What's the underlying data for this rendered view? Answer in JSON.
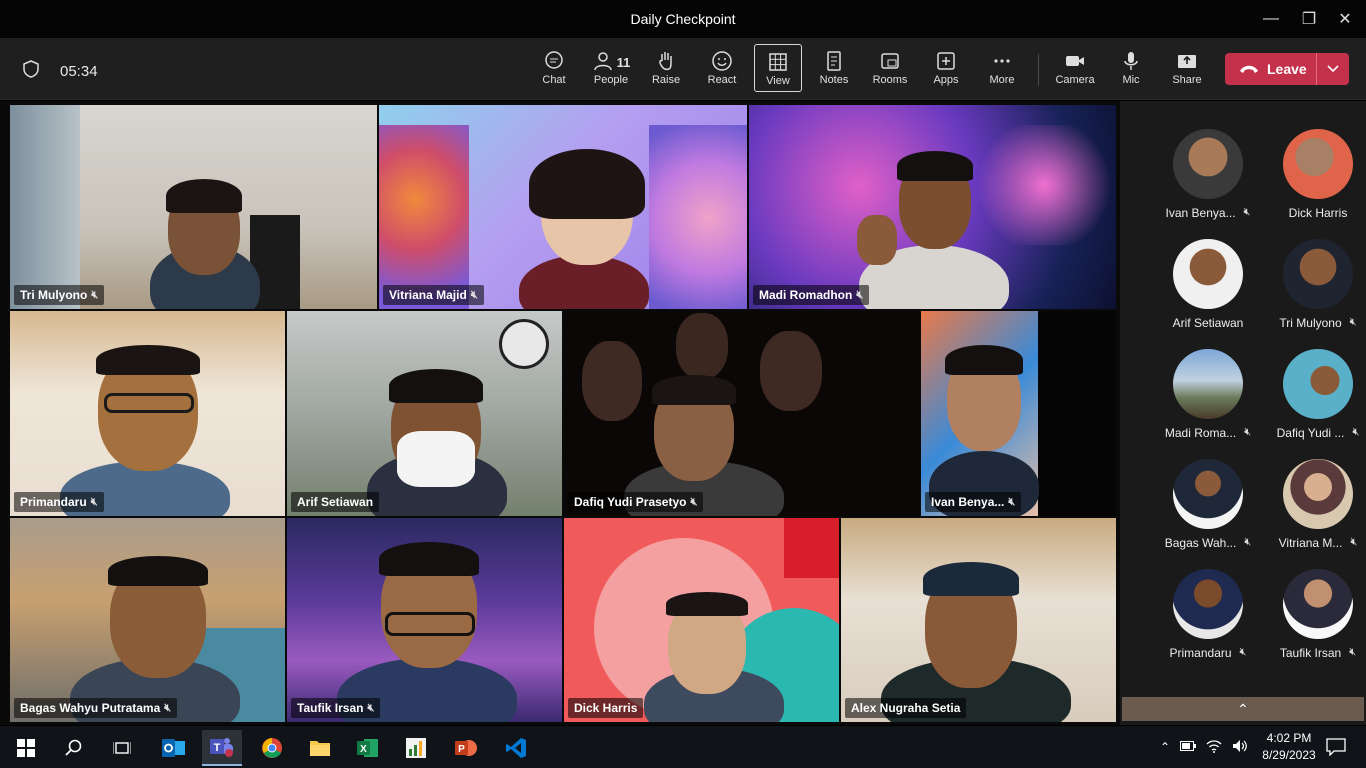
{
  "window": {
    "title": "Daily Checkpoint"
  },
  "meeting": {
    "timer": "05:34"
  },
  "toolbar": {
    "chat": "Chat",
    "people": "People",
    "people_count": "11",
    "raise": "Raise",
    "react": "React",
    "view": "View",
    "notes": "Notes",
    "rooms": "Rooms",
    "apps": "Apps",
    "more": "More",
    "camera": "Camera",
    "mic": "Mic",
    "share": "Share",
    "leave": "Leave"
  },
  "tiles": [
    {
      "name": "Tri Mulyono"
    },
    {
      "name": "Vitriana Majid"
    },
    {
      "name": "Madi Romadhon"
    },
    {
      "name": "Primandaru"
    },
    {
      "name": "Arif Setiawan"
    },
    {
      "name": "Dafiq Yudi Prasetyo"
    },
    {
      "name": "Ivan Benya..."
    },
    {
      "name": "Bagas Wahyu Putratama"
    },
    {
      "name": "Taufik Irsan"
    },
    {
      "name": "Dick Harris"
    },
    {
      "name": "Alex Nugraha Setia"
    }
  ],
  "roster": [
    {
      "name": "Ivan Benya..."
    },
    {
      "name": "Dick Harris"
    },
    {
      "name": "Arif Setiawan"
    },
    {
      "name": "Tri Mulyono"
    },
    {
      "name": "Madi Roma..."
    },
    {
      "name": "Dafiq Yudi ..."
    },
    {
      "name": "Bagas Wah..."
    },
    {
      "name": "Vitriana M..."
    },
    {
      "name": "Primandaru"
    },
    {
      "name": "Taufik Irsan"
    }
  ],
  "taskbar": {
    "time": "4:02 PM",
    "date": "8/29/2023"
  }
}
